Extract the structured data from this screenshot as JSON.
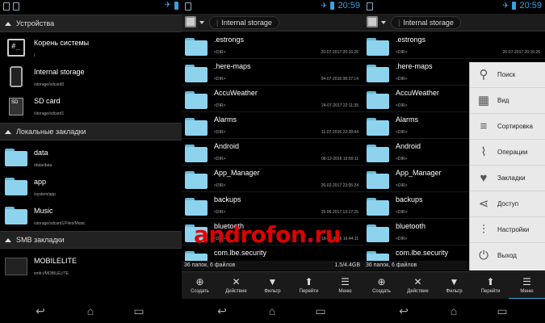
{
  "status": {
    "time": "20:59"
  },
  "sidebar": {
    "sections": [
      {
        "title": "Устройства",
        "items": [
          {
            "title": "Корень системы",
            "sub": "/",
            "icon": "terminal-icon"
          },
          {
            "title": "Internal storage",
            "sub": "/storage/sdcard0",
            "icon": "phone-icon"
          },
          {
            "title": "SD card",
            "sub": "/storage/sdcard1",
            "icon": "sd-card-icon"
          }
        ]
      },
      {
        "title": "Локальные закладки",
        "items": [
          {
            "title": "data",
            "sub": "/data/data",
            "icon": "folder-icon"
          },
          {
            "title": "app",
            "sub": "/system/app",
            "icon": "folder-icon"
          },
          {
            "title": "Music",
            "sub": "/storage/sdcard1/Files/Music",
            "icon": "folder-icon"
          }
        ]
      },
      {
        "title": "SMB закладки",
        "items": [
          {
            "title": "MOBILELITE",
            "sub": "smb://MOBILELITE",
            "icon": "network-pc-icon"
          }
        ]
      }
    ]
  },
  "path": "Internal storage",
  "files": [
    {
      "name": ".estrongs",
      "meta": "<DIR>",
      "date": "20-07-2017 20:16:26"
    },
    {
      "name": ".here-maps",
      "meta": "<DIR>",
      "date": "04-07-2016 08:37:14"
    },
    {
      "name": "AccuWeather",
      "meta": "<DIR>",
      "date": "24-07-2017 22:11:35"
    },
    {
      "name": "Alarms",
      "meta": "<DIR>",
      "date": "11-07-2016 22:28:44"
    },
    {
      "name": "Android",
      "meta": "<DIR>",
      "date": "08-12-2016 19:50:11"
    },
    {
      "name": "App_Manager",
      "meta": "<DIR>",
      "date": "26-02-2017 23:05:24"
    },
    {
      "name": "backups",
      "meta": "<DIR>",
      "date": "15-06-2017 13:17:25"
    },
    {
      "name": "bluetooth",
      "meta": "<DIR>",
      "date": "18-12-2016 16:44:11"
    },
    {
      "name": "com.lbe.security",
      "meta": "",
      "date": ""
    }
  ],
  "under_names": [
    ".es",
    ".he",
    "Acc",
    "Ala",
    "And",
    "Ap",
    "ba",
    "blue",
    "co"
  ],
  "footer": {
    "left_stub": "36 папок, 6 ф",
    "count": "36 папок, 6 файлов",
    "size": "1.5/4.4GB"
  },
  "bottom_actions": [
    {
      "label": "Создать",
      "icon": "plus-icon",
      "glyph": "⊕"
    },
    {
      "label": "Действие",
      "icon": "tools-icon",
      "glyph": "✕"
    },
    {
      "label": "Фильтр",
      "icon": "filter-icon",
      "glyph": "▼"
    },
    {
      "label": "Перейти",
      "icon": "go-up-icon",
      "glyph": "⬆"
    },
    {
      "label": "Меню",
      "icon": "menu-icon",
      "glyph": "☰"
    }
  ],
  "menu_items": [
    {
      "label": "Поиск",
      "icon": "search-icon",
      "glyph": "⚲"
    },
    {
      "label": "Вид",
      "icon": "grid-view-icon",
      "glyph": "▦"
    },
    {
      "label": "Сортировка",
      "icon": "sort-icon",
      "glyph": "≡"
    },
    {
      "label": "Операции",
      "icon": "chart-icon",
      "glyph": "⌇"
    },
    {
      "label": "Закладки",
      "icon": "heart-icon",
      "glyph": "♥"
    },
    {
      "label": "Доступ",
      "icon": "share-icon",
      "glyph": "⋖"
    },
    {
      "label": "Настройки",
      "icon": "sliders-icon",
      "glyph": "⫶"
    },
    {
      "label": "Выход",
      "icon": "power-icon",
      "glyph": "⏻"
    }
  ],
  "nav": {
    "back": "↩",
    "home": "⌂",
    "recent": "▭"
  },
  "watermark": "androfon.ru"
}
